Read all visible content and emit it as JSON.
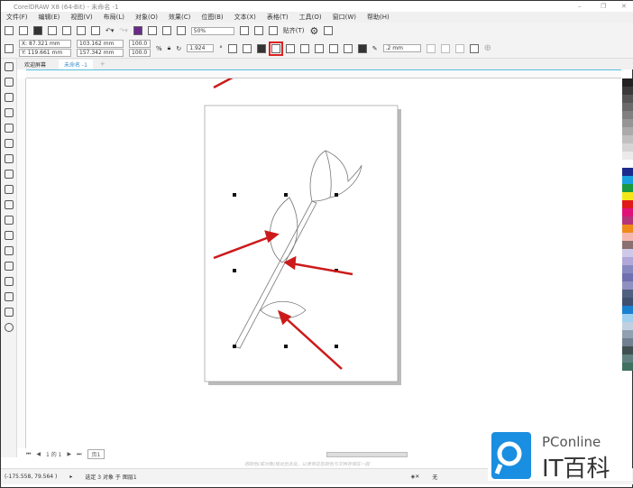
{
  "title": "CorelDRAW X8 (64-Bit) - 未命名 -1",
  "menu": [
    "文件(F)",
    "编辑(E)",
    "视图(V)",
    "布局(L)",
    "对象(O)",
    "效果(C)",
    "位图(B)",
    "文本(X)",
    "表格(T)",
    "工具(O)",
    "窗口(W)",
    "帮助(H)"
  ],
  "toolbar": {
    "zoom": "50%",
    "snap": "贴齐(T)"
  },
  "propbar": {
    "x": "X: 87.321 mm",
    "y": "Y: 119.661 mm",
    "width": "103.162 mm",
    "height": "157.342 mm",
    "scale_x": "100.0",
    "scale_y": "100.0",
    "pct": "%",
    "angle": "1.924",
    "outline": ".2 mm"
  },
  "tabs": {
    "welcome": "欢迎屏幕",
    "doc": "未命名 -1"
  },
  "pagenav": {
    "page_of": "1 的 1",
    "page_tab": "页1"
  },
  "hint": "将颜色(或对象)拖动至此处，以便将这些颜色与文档存储在一起",
  "status": {
    "coords": "(-175.558, 79.564 )",
    "selection": "选定 3 对象 于 图层1",
    "fill": "无"
  },
  "watermark": {
    "brand": "PConline",
    "name": "IT百科"
  },
  "palette": [
    "#222222",
    "#3a3a3a",
    "#555555",
    "#6a6a6a",
    "#808080",
    "#959595",
    "#aaaaaa",
    "#c0c0c0",
    "#d5d5d5",
    "#eaeaea",
    "#ffffff",
    "#1b2a8c",
    "#1aa0e0",
    "#1a9a40",
    "#f5e61a",
    "#e01a1a",
    "#e0127a",
    "#b5357a",
    "#f08a1a",
    "#f5b8b0",
    "#8a7070",
    "#d0c8e8",
    "#b0a8d8",
    "#8888c0",
    "#7070b0",
    "#9090c0",
    "#506080",
    "#405070",
    "#1a80d0",
    "#a0d0f0",
    "#c0d0e0",
    "#90a0b0",
    "#708090",
    "#405050",
    "#608080",
    "#407060"
  ]
}
